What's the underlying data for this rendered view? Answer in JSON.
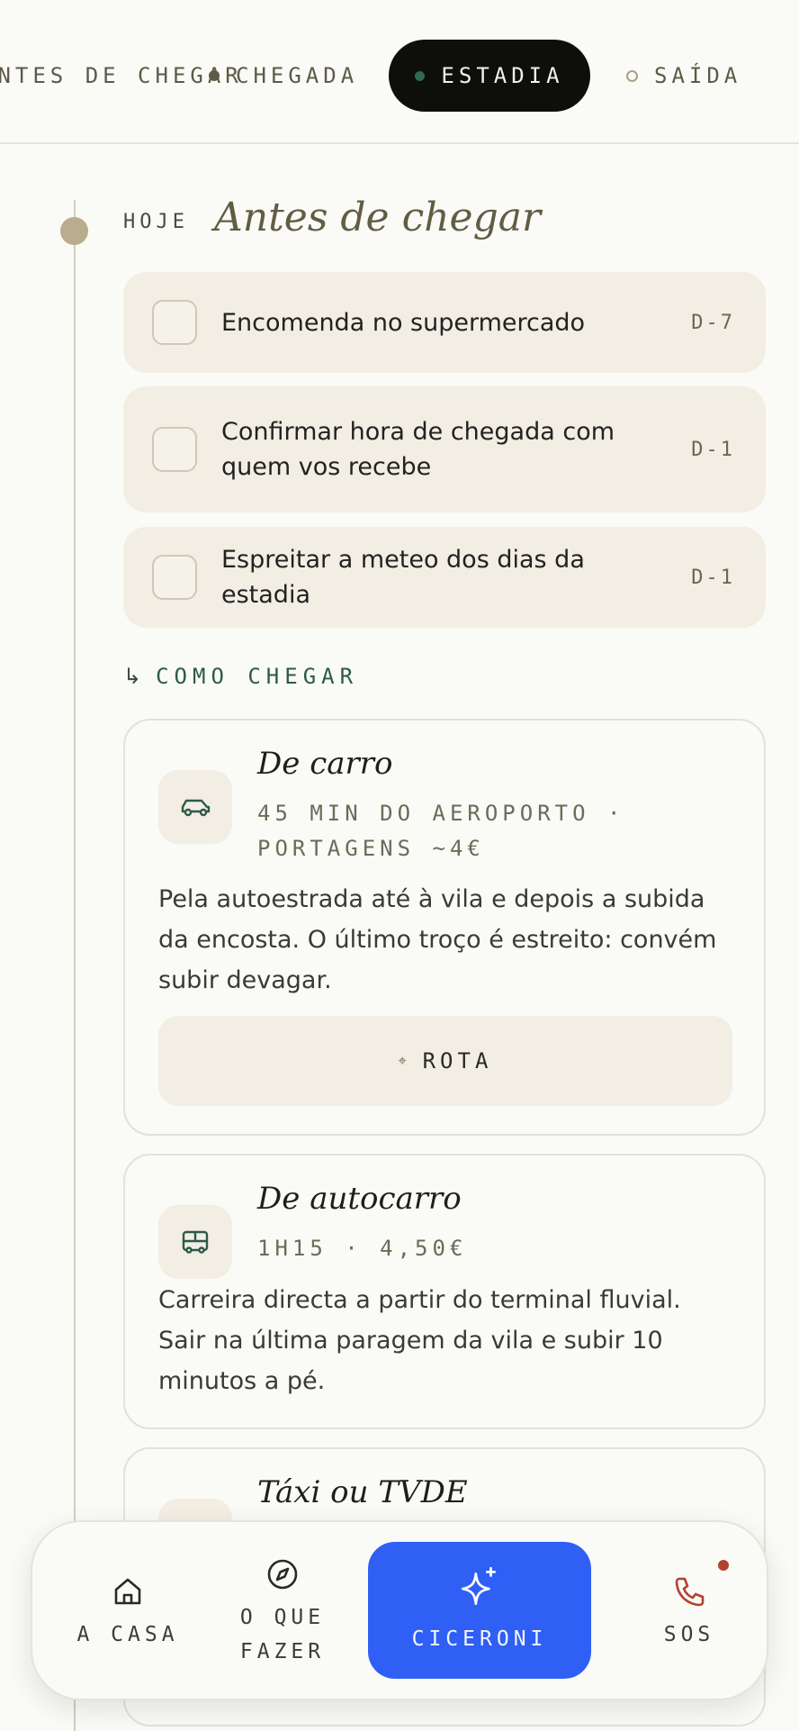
{
  "tabs": [
    {
      "label": "ANTES DE CHEGAR"
    },
    {
      "label": "CHEGADA"
    },
    {
      "label": "ESTADIA",
      "active": true
    },
    {
      "label": "SAÍDA"
    }
  ],
  "timeline": {
    "today_label": "HOJE",
    "section_title": "Antes de chegar"
  },
  "tasks": [
    {
      "text": "Encomenda no supermercado",
      "due": "D-7",
      "checked": false
    },
    {
      "text": "Confirmar hora de chegada com quem vos recebe",
      "due": "D-1",
      "checked": false
    },
    {
      "text": "Espreitar a meteo dos dias da estadia",
      "due": "D-1",
      "checked": false
    }
  ],
  "how_to_arrive": {
    "arrow": "↳",
    "heading": "COMO CHEGAR",
    "options": [
      {
        "icon": "car-icon",
        "title": "De carro",
        "meta": "45 MIN DO AEROPORTO · PORTAGENS ~4€",
        "description": "Pela autoestrada até à vila e depois a subida da encosta. O último troço é estreito: convém subir devagar.",
        "button_symbol": "⌖",
        "button_label": "ROTA"
      },
      {
        "icon": "bus-icon",
        "title": "De autocarro",
        "meta": "1H15 · 4,50€",
        "description": "Carreira directa a partir do terminal fluvial. Sair na última paragem da vila e subir 10 minutos a pé."
      },
      {
        "icon": "taxi-icon",
        "title": "Táxi ou TVDE"
      }
    ]
  },
  "bottom_nav": {
    "home": {
      "label": "A CASA",
      "icon": "home-icon"
    },
    "what_to_do": {
      "label": "O QUE FAZER",
      "icon": "compass-icon"
    },
    "assistant": {
      "label": "CICERONI",
      "icon": "sparkle-icon"
    },
    "sos": {
      "label": "SOS",
      "icon": "phone-icon"
    }
  },
  "colors": {
    "background": "#fafaf7",
    "card": "#f2eee3",
    "accent_blue": "#2f5ff5",
    "active_tab": "#0e0e0c",
    "green": "#2d5a49",
    "sos_dot": "#b4412f"
  }
}
